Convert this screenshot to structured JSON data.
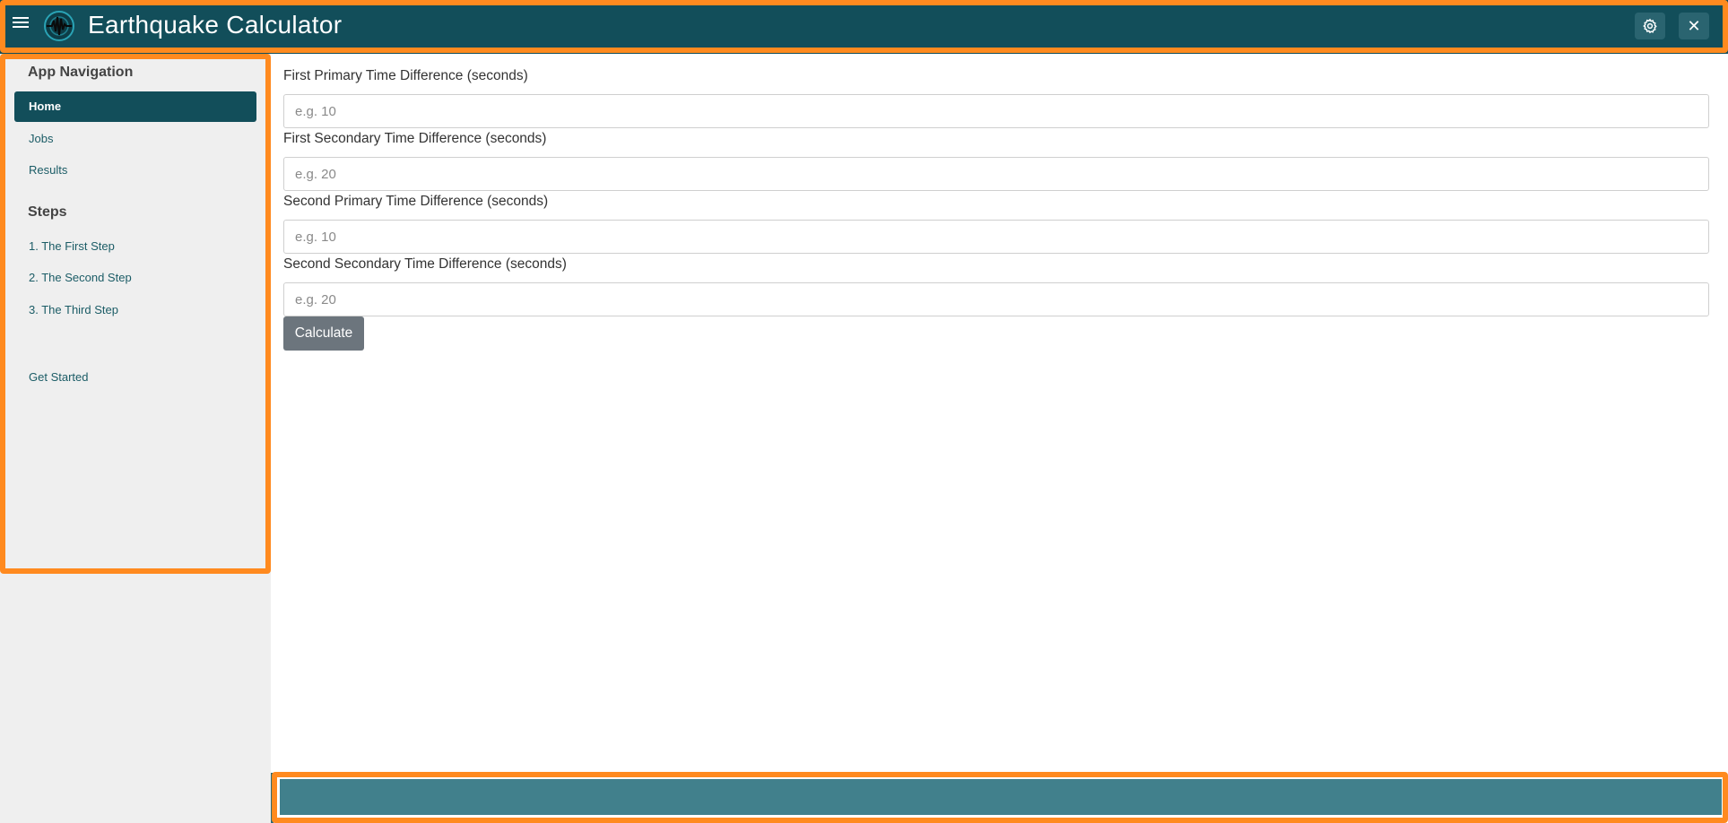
{
  "header": {
    "title": "Earthquake Calculator",
    "menu_icon": "hamburger-menu-icon",
    "logo_icon": "seismograph-logo-icon",
    "settings_icon": "gear-icon",
    "close_icon": "close-icon",
    "close_glyph": "✕"
  },
  "sidebar": {
    "nav_heading": "App Navigation",
    "nav_items": [
      {
        "label": "Home",
        "active": true
      },
      {
        "label": "Jobs",
        "active": false
      },
      {
        "label": "Results",
        "active": false
      }
    ],
    "steps_heading": "Steps",
    "steps": [
      {
        "label": "1. The First Step"
      },
      {
        "label": "2. The Second Step"
      },
      {
        "label": "3. The Third Step"
      }
    ],
    "get_started": "Get Started"
  },
  "form": {
    "fields": [
      {
        "label": "First Primary Time Difference (seconds)",
        "placeholder": "e.g. 10",
        "value": ""
      },
      {
        "label": "First Secondary Time Difference (seconds)",
        "placeholder": "e.g. 20",
        "value": ""
      },
      {
        "label": "Second Primary Time Difference (seconds)",
        "placeholder": "e.g. 10",
        "value": ""
      },
      {
        "label": "Second Secondary Time Difference (seconds)",
        "placeholder": "e.g. 20",
        "value": ""
      }
    ],
    "submit_label": "Calculate"
  },
  "colors": {
    "header_bg": "#124e5a",
    "sidebar_bg": "#efefef",
    "active_nav": "#124e5a",
    "button_bg": "#6c757d",
    "footer_bg": "#41808c",
    "highlight": "#ff8a1f"
  }
}
